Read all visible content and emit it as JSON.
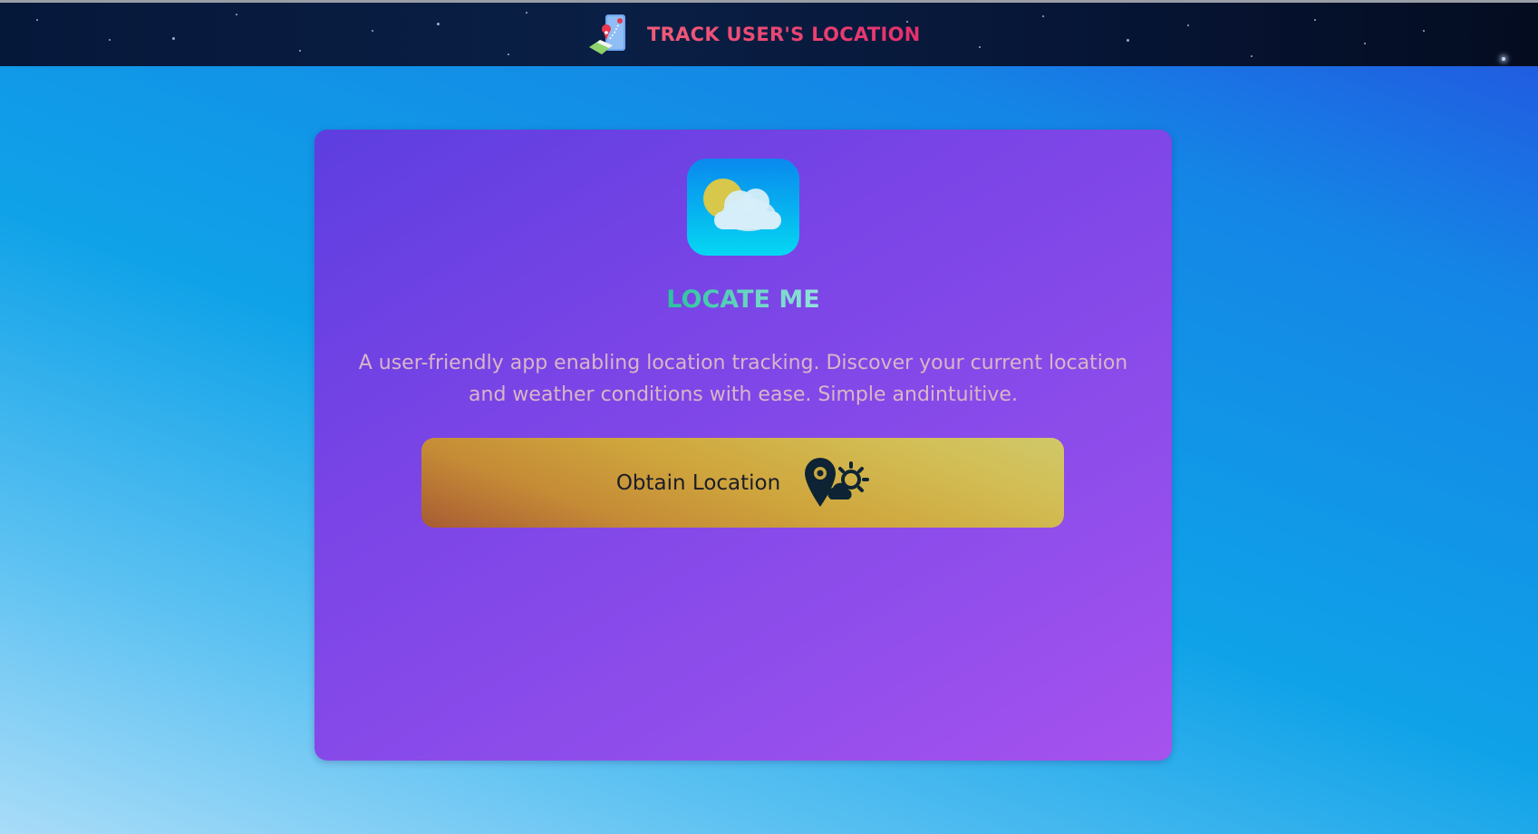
{
  "navbar": {
    "title": "TRACK USER'S LOCATION",
    "logo_icon": "map-phone-icon"
  },
  "card": {
    "icon": "weather-cloud-sun-icon",
    "heading": "LOCATE ME",
    "description": "A user-friendly app enabling location tracking. Discover your current location and weather conditions with ease. Simple andintuitive.",
    "button_label": "Obtain Location",
    "button_icon": "location-weather-icon"
  },
  "colors": {
    "navbar_bg": "#081a3c",
    "title_accent": "#e83a6f",
    "card_gradient_start": "#5d3ee0",
    "card_gradient_end": "#a652ee",
    "heading_accent": "#3dc9a8",
    "button_gold": "#cfa63d",
    "page_blue": "#0fa2e8"
  }
}
